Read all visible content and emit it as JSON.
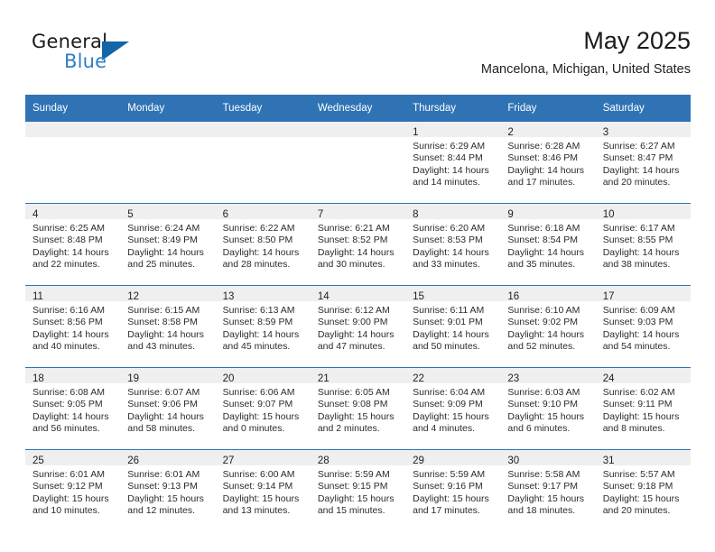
{
  "brand": {
    "name_part1": "General",
    "name_part2": "Blue",
    "flag_icon": "triangle-flag-icon",
    "accent_color": "#2f7fc4"
  },
  "header": {
    "title": "May 2025",
    "subtitle": "Mancelona, Michigan, United States"
  },
  "calendar": {
    "header_bg": "#2f73b5",
    "daynum_bg": "#efefef",
    "weekdays": [
      "Sunday",
      "Monday",
      "Tuesday",
      "Wednesday",
      "Thursday",
      "Friday",
      "Saturday"
    ],
    "weeks": [
      [
        {
          "day": "",
          "sunrise": "",
          "sunset": "",
          "daylight_line1": "",
          "daylight_line2": "",
          "empty": true
        },
        {
          "day": "",
          "sunrise": "",
          "sunset": "",
          "daylight_line1": "",
          "daylight_line2": "",
          "empty": true
        },
        {
          "day": "",
          "sunrise": "",
          "sunset": "",
          "daylight_line1": "",
          "daylight_line2": "",
          "empty": true
        },
        {
          "day": "",
          "sunrise": "",
          "sunset": "",
          "daylight_line1": "",
          "daylight_line2": "",
          "empty": true
        },
        {
          "day": "1",
          "sunrise": "Sunrise: 6:29 AM",
          "sunset": "Sunset: 8:44 PM",
          "daylight_line1": "Daylight: 14 hours",
          "daylight_line2": "and 14 minutes."
        },
        {
          "day": "2",
          "sunrise": "Sunrise: 6:28 AM",
          "sunset": "Sunset: 8:46 PM",
          "daylight_line1": "Daylight: 14 hours",
          "daylight_line2": "and 17 minutes."
        },
        {
          "day": "3",
          "sunrise": "Sunrise: 6:27 AM",
          "sunset": "Sunset: 8:47 PM",
          "daylight_line1": "Daylight: 14 hours",
          "daylight_line2": "and 20 minutes."
        }
      ],
      [
        {
          "day": "4",
          "sunrise": "Sunrise: 6:25 AM",
          "sunset": "Sunset: 8:48 PM",
          "daylight_line1": "Daylight: 14 hours",
          "daylight_line2": "and 22 minutes."
        },
        {
          "day": "5",
          "sunrise": "Sunrise: 6:24 AM",
          "sunset": "Sunset: 8:49 PM",
          "daylight_line1": "Daylight: 14 hours",
          "daylight_line2": "and 25 minutes."
        },
        {
          "day": "6",
          "sunrise": "Sunrise: 6:22 AM",
          "sunset": "Sunset: 8:50 PM",
          "daylight_line1": "Daylight: 14 hours",
          "daylight_line2": "and 28 minutes."
        },
        {
          "day": "7",
          "sunrise": "Sunrise: 6:21 AM",
          "sunset": "Sunset: 8:52 PM",
          "daylight_line1": "Daylight: 14 hours",
          "daylight_line2": "and 30 minutes."
        },
        {
          "day": "8",
          "sunrise": "Sunrise: 6:20 AM",
          "sunset": "Sunset: 8:53 PM",
          "daylight_line1": "Daylight: 14 hours",
          "daylight_line2": "and 33 minutes."
        },
        {
          "day": "9",
          "sunrise": "Sunrise: 6:18 AM",
          "sunset": "Sunset: 8:54 PM",
          "daylight_line1": "Daylight: 14 hours",
          "daylight_line2": "and 35 minutes."
        },
        {
          "day": "10",
          "sunrise": "Sunrise: 6:17 AM",
          "sunset": "Sunset: 8:55 PM",
          "daylight_line1": "Daylight: 14 hours",
          "daylight_line2": "and 38 minutes."
        }
      ],
      [
        {
          "day": "11",
          "sunrise": "Sunrise: 6:16 AM",
          "sunset": "Sunset: 8:56 PM",
          "daylight_line1": "Daylight: 14 hours",
          "daylight_line2": "and 40 minutes."
        },
        {
          "day": "12",
          "sunrise": "Sunrise: 6:15 AM",
          "sunset": "Sunset: 8:58 PM",
          "daylight_line1": "Daylight: 14 hours",
          "daylight_line2": "and 43 minutes."
        },
        {
          "day": "13",
          "sunrise": "Sunrise: 6:13 AM",
          "sunset": "Sunset: 8:59 PM",
          "daylight_line1": "Daylight: 14 hours",
          "daylight_line2": "and 45 minutes."
        },
        {
          "day": "14",
          "sunrise": "Sunrise: 6:12 AM",
          "sunset": "Sunset: 9:00 PM",
          "daylight_line1": "Daylight: 14 hours",
          "daylight_line2": "and 47 minutes."
        },
        {
          "day": "15",
          "sunrise": "Sunrise: 6:11 AM",
          "sunset": "Sunset: 9:01 PM",
          "daylight_line1": "Daylight: 14 hours",
          "daylight_line2": "and 50 minutes."
        },
        {
          "day": "16",
          "sunrise": "Sunrise: 6:10 AM",
          "sunset": "Sunset: 9:02 PM",
          "daylight_line1": "Daylight: 14 hours",
          "daylight_line2": "and 52 minutes."
        },
        {
          "day": "17",
          "sunrise": "Sunrise: 6:09 AM",
          "sunset": "Sunset: 9:03 PM",
          "daylight_line1": "Daylight: 14 hours",
          "daylight_line2": "and 54 minutes."
        }
      ],
      [
        {
          "day": "18",
          "sunrise": "Sunrise: 6:08 AM",
          "sunset": "Sunset: 9:05 PM",
          "daylight_line1": "Daylight: 14 hours",
          "daylight_line2": "and 56 minutes."
        },
        {
          "day": "19",
          "sunrise": "Sunrise: 6:07 AM",
          "sunset": "Sunset: 9:06 PM",
          "daylight_line1": "Daylight: 14 hours",
          "daylight_line2": "and 58 minutes."
        },
        {
          "day": "20",
          "sunrise": "Sunrise: 6:06 AM",
          "sunset": "Sunset: 9:07 PM",
          "daylight_line1": "Daylight: 15 hours",
          "daylight_line2": "and 0 minutes."
        },
        {
          "day": "21",
          "sunrise": "Sunrise: 6:05 AM",
          "sunset": "Sunset: 9:08 PM",
          "daylight_line1": "Daylight: 15 hours",
          "daylight_line2": "and 2 minutes."
        },
        {
          "day": "22",
          "sunrise": "Sunrise: 6:04 AM",
          "sunset": "Sunset: 9:09 PM",
          "daylight_line1": "Daylight: 15 hours",
          "daylight_line2": "and 4 minutes."
        },
        {
          "day": "23",
          "sunrise": "Sunrise: 6:03 AM",
          "sunset": "Sunset: 9:10 PM",
          "daylight_line1": "Daylight: 15 hours",
          "daylight_line2": "and 6 minutes."
        },
        {
          "day": "24",
          "sunrise": "Sunrise: 6:02 AM",
          "sunset": "Sunset: 9:11 PM",
          "daylight_line1": "Daylight: 15 hours",
          "daylight_line2": "and 8 minutes."
        }
      ],
      [
        {
          "day": "25",
          "sunrise": "Sunrise: 6:01 AM",
          "sunset": "Sunset: 9:12 PM",
          "daylight_line1": "Daylight: 15 hours",
          "daylight_line2": "and 10 minutes."
        },
        {
          "day": "26",
          "sunrise": "Sunrise: 6:01 AM",
          "sunset": "Sunset: 9:13 PM",
          "daylight_line1": "Daylight: 15 hours",
          "daylight_line2": "and 12 minutes."
        },
        {
          "day": "27",
          "sunrise": "Sunrise: 6:00 AM",
          "sunset": "Sunset: 9:14 PM",
          "daylight_line1": "Daylight: 15 hours",
          "daylight_line2": "and 13 minutes."
        },
        {
          "day": "28",
          "sunrise": "Sunrise: 5:59 AM",
          "sunset": "Sunset: 9:15 PM",
          "daylight_line1": "Daylight: 15 hours",
          "daylight_line2": "and 15 minutes."
        },
        {
          "day": "29",
          "sunrise": "Sunrise: 5:59 AM",
          "sunset": "Sunset: 9:16 PM",
          "daylight_line1": "Daylight: 15 hours",
          "daylight_line2": "and 17 minutes."
        },
        {
          "day": "30",
          "sunrise": "Sunrise: 5:58 AM",
          "sunset": "Sunset: 9:17 PM",
          "daylight_line1": "Daylight: 15 hours",
          "daylight_line2": "and 18 minutes."
        },
        {
          "day": "31",
          "sunrise": "Sunrise: 5:57 AM",
          "sunset": "Sunset: 9:18 PM",
          "daylight_line1": "Daylight: 15 hours",
          "daylight_line2": "and 20 minutes."
        }
      ]
    ]
  }
}
